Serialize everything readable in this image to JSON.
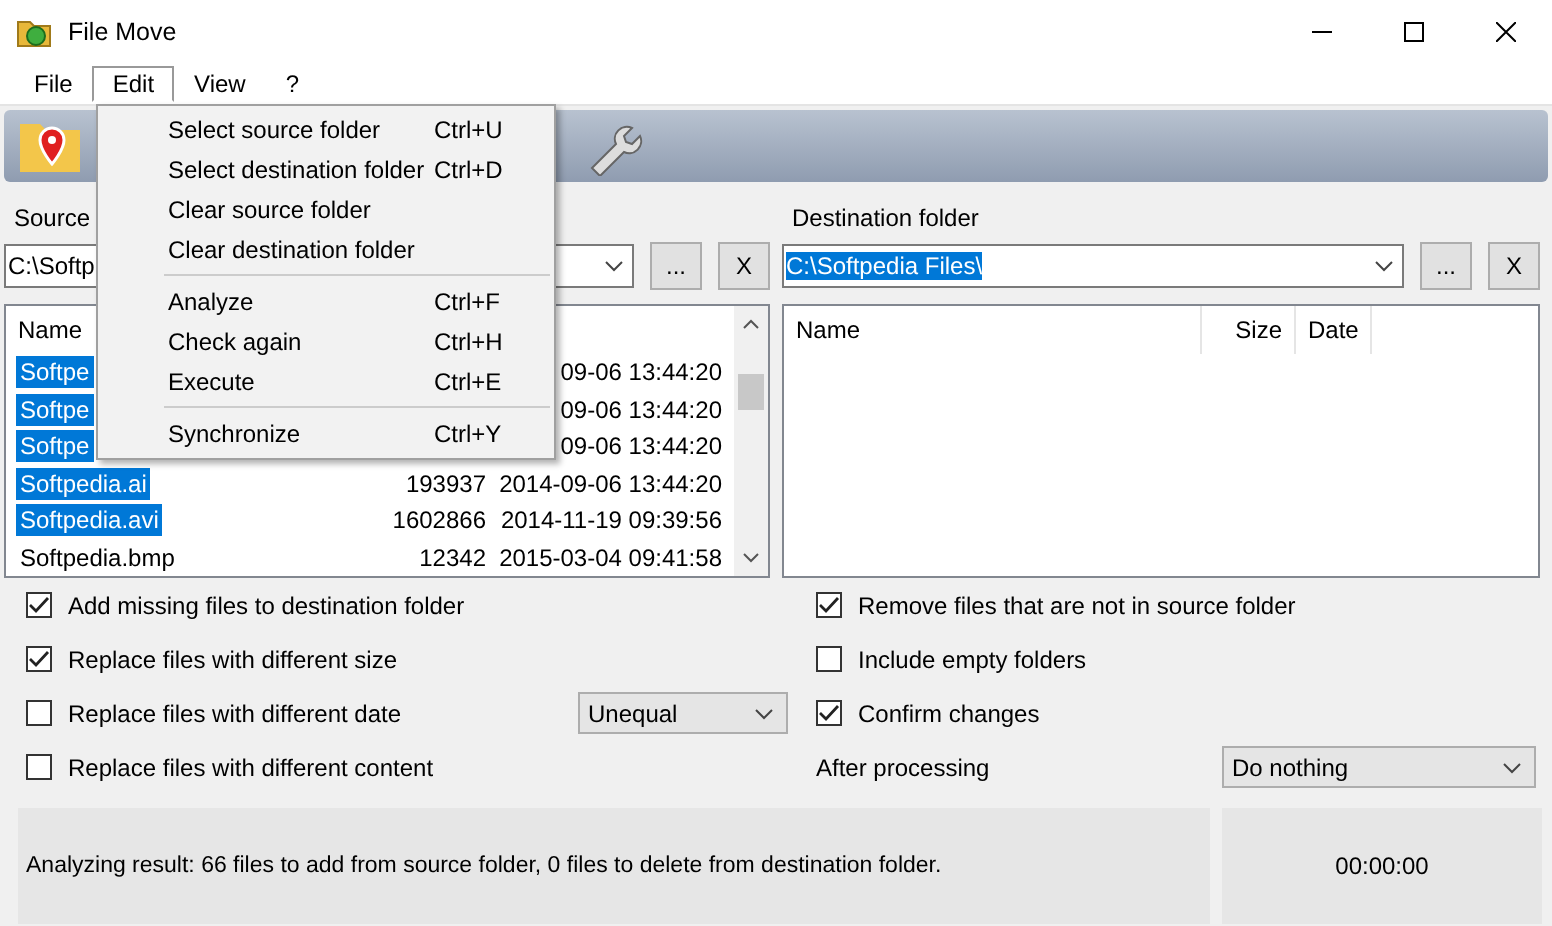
{
  "window": {
    "title": "File Move"
  },
  "menu_bar": [
    {
      "label": "File",
      "selected": false
    },
    {
      "label": "Edit",
      "selected": true
    },
    {
      "label": "View",
      "selected": false
    },
    {
      "label": "?",
      "selected": false
    }
  ],
  "edit_menu": [
    {
      "kind": "item",
      "label": "Select source folder",
      "shortcut": "Ctrl+U"
    },
    {
      "kind": "item",
      "label": "Select destination folder",
      "shortcut": "Ctrl+D"
    },
    {
      "kind": "item",
      "label": "Clear source folder"
    },
    {
      "kind": "item",
      "label": "Clear destination folder"
    },
    {
      "kind": "separator"
    },
    {
      "kind": "item",
      "label": "Analyze",
      "shortcut": "Ctrl+F"
    },
    {
      "kind": "item",
      "label": "Check again",
      "shortcut": "Ctrl+H"
    },
    {
      "kind": "item",
      "label": "Execute",
      "shortcut": "Ctrl+E"
    },
    {
      "kind": "separator"
    },
    {
      "kind": "item",
      "label": "Synchronize",
      "shortcut": "Ctrl+Y"
    }
  ],
  "source": {
    "label": "Source",
    "path": "C:\\Softp",
    "path_highlighted": false,
    "browse": "...",
    "clear": "X",
    "columns": [
      "Name"
    ],
    "rows": [
      {
        "name": "Softpe",
        "date": "09-06 13:44:20",
        "selected": true
      },
      {
        "name": "Softpe",
        "date": "09-06 13:44:20",
        "selected": true
      },
      {
        "name": "Softpe",
        "date": "09-06 13:44:20",
        "selected": true
      },
      {
        "name": "Softpedia.ai",
        "size": "193937",
        "date": "2014-09-06 13:44:20",
        "selected": true
      },
      {
        "name": "Softpedia.avi",
        "size": "1602866",
        "date": "2014-11-19 09:39:56",
        "selected": true
      },
      {
        "name": "Softpedia.bmp",
        "size": "12342",
        "date": "2015-03-04 09:41:58",
        "selected": false
      }
    ]
  },
  "destination": {
    "label": "Destination folder",
    "path": "C:\\Softpedia Files\\",
    "path_highlighted": true,
    "browse": "...",
    "clear": "X",
    "columns": [
      "Name",
      "Size",
      "Date"
    ]
  },
  "options_left": [
    {
      "kind": "checkbox",
      "label": "Add missing files to destination folder",
      "checked": true
    },
    {
      "kind": "checkbox",
      "label": "Replace files with different size",
      "checked": true
    },
    {
      "kind": "checkbox",
      "label": "Replace files with different date",
      "checked": false,
      "select": "Unequal"
    },
    {
      "kind": "checkbox",
      "label": "Replace files with different content",
      "checked": false
    }
  ],
  "options_right": [
    {
      "kind": "checkbox",
      "label": "Remove files that are not in source folder",
      "checked": true
    },
    {
      "kind": "checkbox",
      "label": "Include empty folders",
      "checked": false
    },
    {
      "kind": "checkbox",
      "label": "Confirm changes",
      "checked": true
    },
    {
      "kind": "select",
      "label": "After processing",
      "select": "Do nothing"
    }
  ],
  "status": {
    "message": "Analyzing result: 66 files to add from source folder, 0 files to delete from destination folder.",
    "time": "00:00:00"
  }
}
